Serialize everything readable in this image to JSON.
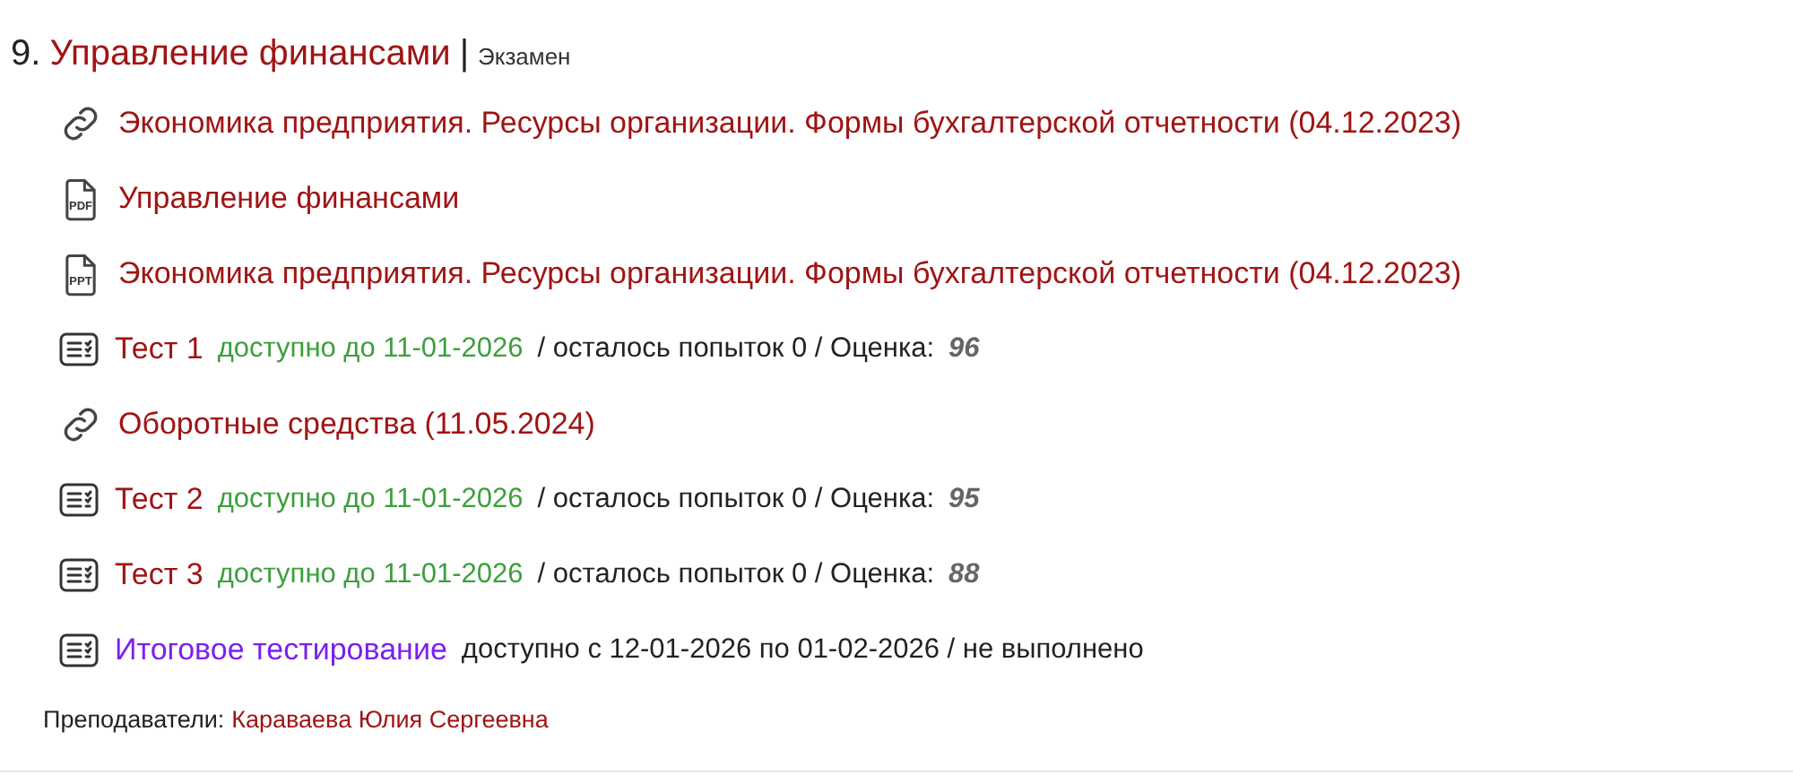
{
  "course": {
    "number": "9.",
    "title": "Управление финансами",
    "separator": "|",
    "type": "Экзамен"
  },
  "items": [
    {
      "kind": "link",
      "title": "Экономика предприятия. Ресурсы организации. Формы бухгалтерской отчетности (04.12.2023)"
    },
    {
      "kind": "file",
      "icon_label": "PDF",
      "title": "Управление финансами"
    },
    {
      "kind": "file",
      "icon_label": "PPT",
      "title": "Экономика предприятия. Ресурсы организации. Формы бухгалтерской отчетности (04.12.2023)"
    },
    {
      "kind": "test",
      "title": "Тест 1",
      "availability": "доступно до 11-01-2026",
      "status": "/ осталось попыток 0 / Оценка:",
      "grade": "96"
    },
    {
      "kind": "link",
      "title": "Оборотные средства (11.05.2024)"
    },
    {
      "kind": "test",
      "title": "Тест 2",
      "availability": "доступно до 11-01-2026",
      "status": "/ осталось попыток 0 / Оценка:",
      "grade": "95"
    },
    {
      "kind": "test",
      "title": "Тест 3",
      "availability": "доступно до 11-01-2026",
      "status": "/ осталось попыток 0 / Оценка:",
      "grade": "88"
    },
    {
      "kind": "final",
      "title": "Итоговое тестирование",
      "status": "доступно с 12-01-2026 по 01-02-2026 / не выполнено"
    }
  ],
  "teachers": {
    "label": "Преподаватели:",
    "names": "Караваева Юлия Сергеевна"
  }
}
